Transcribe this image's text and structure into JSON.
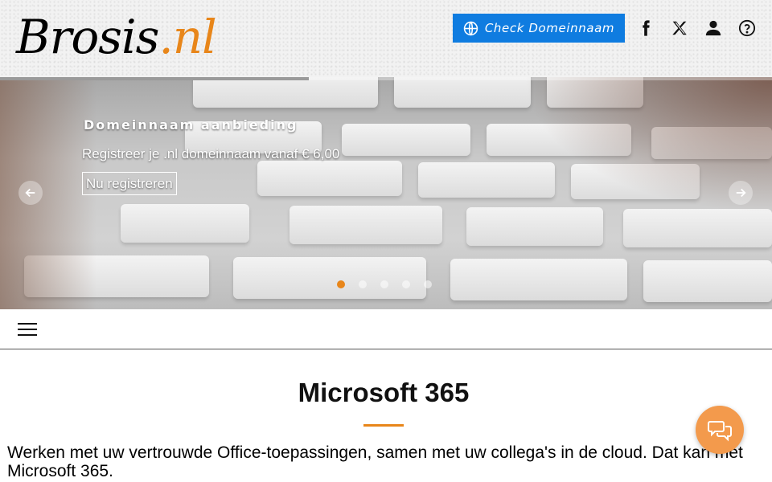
{
  "header": {
    "logo": {
      "name": "Brosis",
      "dot": ".",
      "tld": "nl"
    },
    "check_domain_label": "Check Domeinnaam",
    "icons": [
      "facebook-icon",
      "x-twitter-icon",
      "user-icon",
      "help-icon"
    ]
  },
  "hero": {
    "slide_title": "Domeinnaam aanbieding",
    "slide_subtitle": "Registreer je .nl domeinnaam vanaf € 6,00",
    "cta_label": "Nu registreren",
    "slide_count": 5,
    "active_slide": 1,
    "progress_fraction": 0.4
  },
  "main": {
    "title": "Microsoft 365",
    "intro": "Werken met uw vertrouwde Office-toepassingen, samen met uw collega's in de cloud. Dat kan met Microsoft 365."
  },
  "colors": {
    "accent": "#e8861a",
    "button_blue": "#0f7ce0",
    "chat_orange": "#f39a4c"
  }
}
